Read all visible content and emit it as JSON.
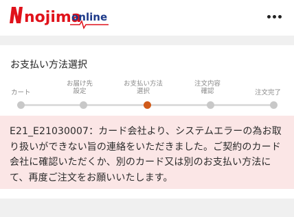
{
  "header": {
    "logo": {
      "brand": "nojima",
      "sub": "online"
    },
    "menu_icon": "more-horizontal-icon"
  },
  "payment": {
    "title": "お支払い方法選択"
  },
  "steps": [
    {
      "line1": "カート",
      "line2": "",
      "active": false
    },
    {
      "line1": "お届け先",
      "line2": "設定",
      "active": false
    },
    {
      "line1": "お支払い方法",
      "line2": "選択",
      "active": true
    },
    {
      "line1": "注文内容",
      "line2": "確認",
      "active": false
    },
    {
      "line1": "注文完了",
      "line2": "",
      "active": false
    }
  ],
  "error": {
    "message": "E21_E21030007：カード会社より、システムエラーの為お取り扱いができない旨の連絡をいただきました。ご契約のカード会社に確認いただくか、別のカード又は別のお支払い方法にて、再度ご注文をお願いいたします。"
  },
  "colors": {
    "brand_red": "#e0121b",
    "brand_blue": "#1d3a8a",
    "active_step": "#d05a1a",
    "error_bg": "#fbe6e6"
  }
}
